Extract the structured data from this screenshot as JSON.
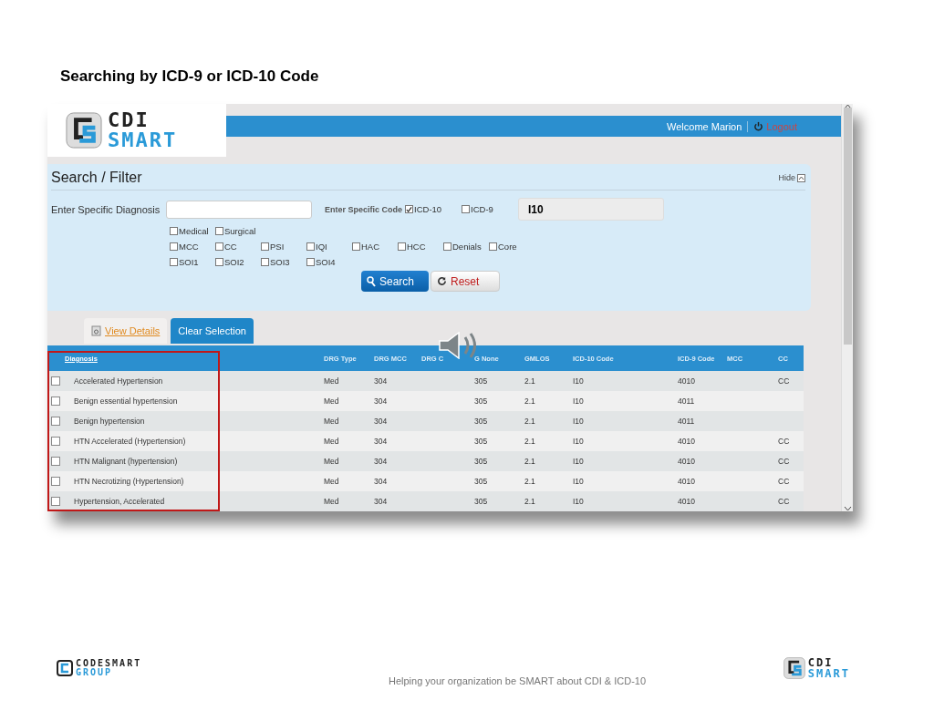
{
  "page_title": "Searching by ICD-9 or ICD-10 Code",
  "app": {
    "logo": {
      "line1": "CDI",
      "line2": "SMART"
    },
    "welcome": "Welcome Marion",
    "logout": "Logout"
  },
  "search_panel": {
    "title": "Search / Filter",
    "hide": "Hide",
    "diagnosis_label": "Enter Specific Diagnosis",
    "code_label": "Enter Specific Code",
    "code_types": [
      {
        "label": "ICD-10",
        "checked": true
      },
      {
        "label": "ICD-9",
        "checked": false
      }
    ],
    "code_value": "I10",
    "filter_rows": [
      [
        {
          "label": "Medical",
          "checked": false
        },
        {
          "label": "Surgical",
          "checked": false
        }
      ],
      [
        {
          "label": "MCC",
          "checked": false
        },
        {
          "label": "CC",
          "checked": false
        },
        {
          "label": "PSI",
          "checked": false
        },
        {
          "label": "IQI",
          "checked": false
        },
        {
          "label": "HAC",
          "checked": false
        },
        {
          "label": "HCC",
          "checked": false
        },
        {
          "label": "Denials",
          "checked": false
        },
        {
          "label": "Core",
          "checked": false
        }
      ],
      [
        {
          "label": "SOI1",
          "checked": false
        },
        {
          "label": "SOI2",
          "checked": false
        },
        {
          "label": "SOI3",
          "checked": false
        },
        {
          "label": "SOI4",
          "checked": false
        }
      ]
    ],
    "search_button": "Search",
    "reset_button": "Reset"
  },
  "actions": [
    {
      "label": "View Details",
      "kind": "link"
    },
    {
      "label": "Clear Selection",
      "kind": "primary"
    }
  ],
  "table": {
    "columns": [
      "Diagnosis",
      "DRG Type",
      "DRG MCC",
      "DRG C",
      "G None",
      "GMLOS",
      "ICD-10 Code",
      "ICD-9 Code",
      "MCC",
      "CC"
    ],
    "rows": [
      {
        "checked": false,
        "cells": [
          "Accelerated Hypertension",
          "Med",
          "304",
          "",
          "305",
          "2.1",
          "I10",
          "4010",
          "",
          "CC"
        ]
      },
      {
        "checked": false,
        "cells": [
          "Benign essential hypertension",
          "Med",
          "304",
          "",
          "305",
          "2.1",
          "I10",
          "4011",
          "",
          ""
        ]
      },
      {
        "checked": false,
        "cells": [
          "Benign hypertension",
          "Med",
          "304",
          "",
          "305",
          "2.1",
          "I10",
          "4011",
          "",
          ""
        ]
      },
      {
        "checked": false,
        "cells": [
          "HTN Accelerated (Hypertension)",
          "Med",
          "304",
          "",
          "305",
          "2.1",
          "I10",
          "4010",
          "",
          "CC"
        ]
      },
      {
        "checked": false,
        "cells": [
          "HTN Malignant (hypertension)",
          "Med",
          "304",
          "",
          "305",
          "2.1",
          "I10",
          "4010",
          "",
          "CC"
        ]
      },
      {
        "checked": false,
        "cells": [
          "HTN Necrotizing (Hypertension)",
          "Med",
          "304",
          "",
          "305",
          "2.1",
          "I10",
          "4010",
          "",
          "CC"
        ]
      },
      {
        "checked": false,
        "cells": [
          "Hypertension, Accelerated",
          "Med",
          "304",
          "",
          "305",
          "2.1",
          "I10",
          "4010",
          "",
          "CC"
        ]
      }
    ]
  },
  "footer": {
    "company_logo": {
      "line1": "CODESMART",
      "line2": "GROUP"
    },
    "tagline": "Helping your organization be SMART about CDI & ICD-10",
    "product_logo": {
      "line1": "CDI",
      "line2": "SMART"
    }
  }
}
